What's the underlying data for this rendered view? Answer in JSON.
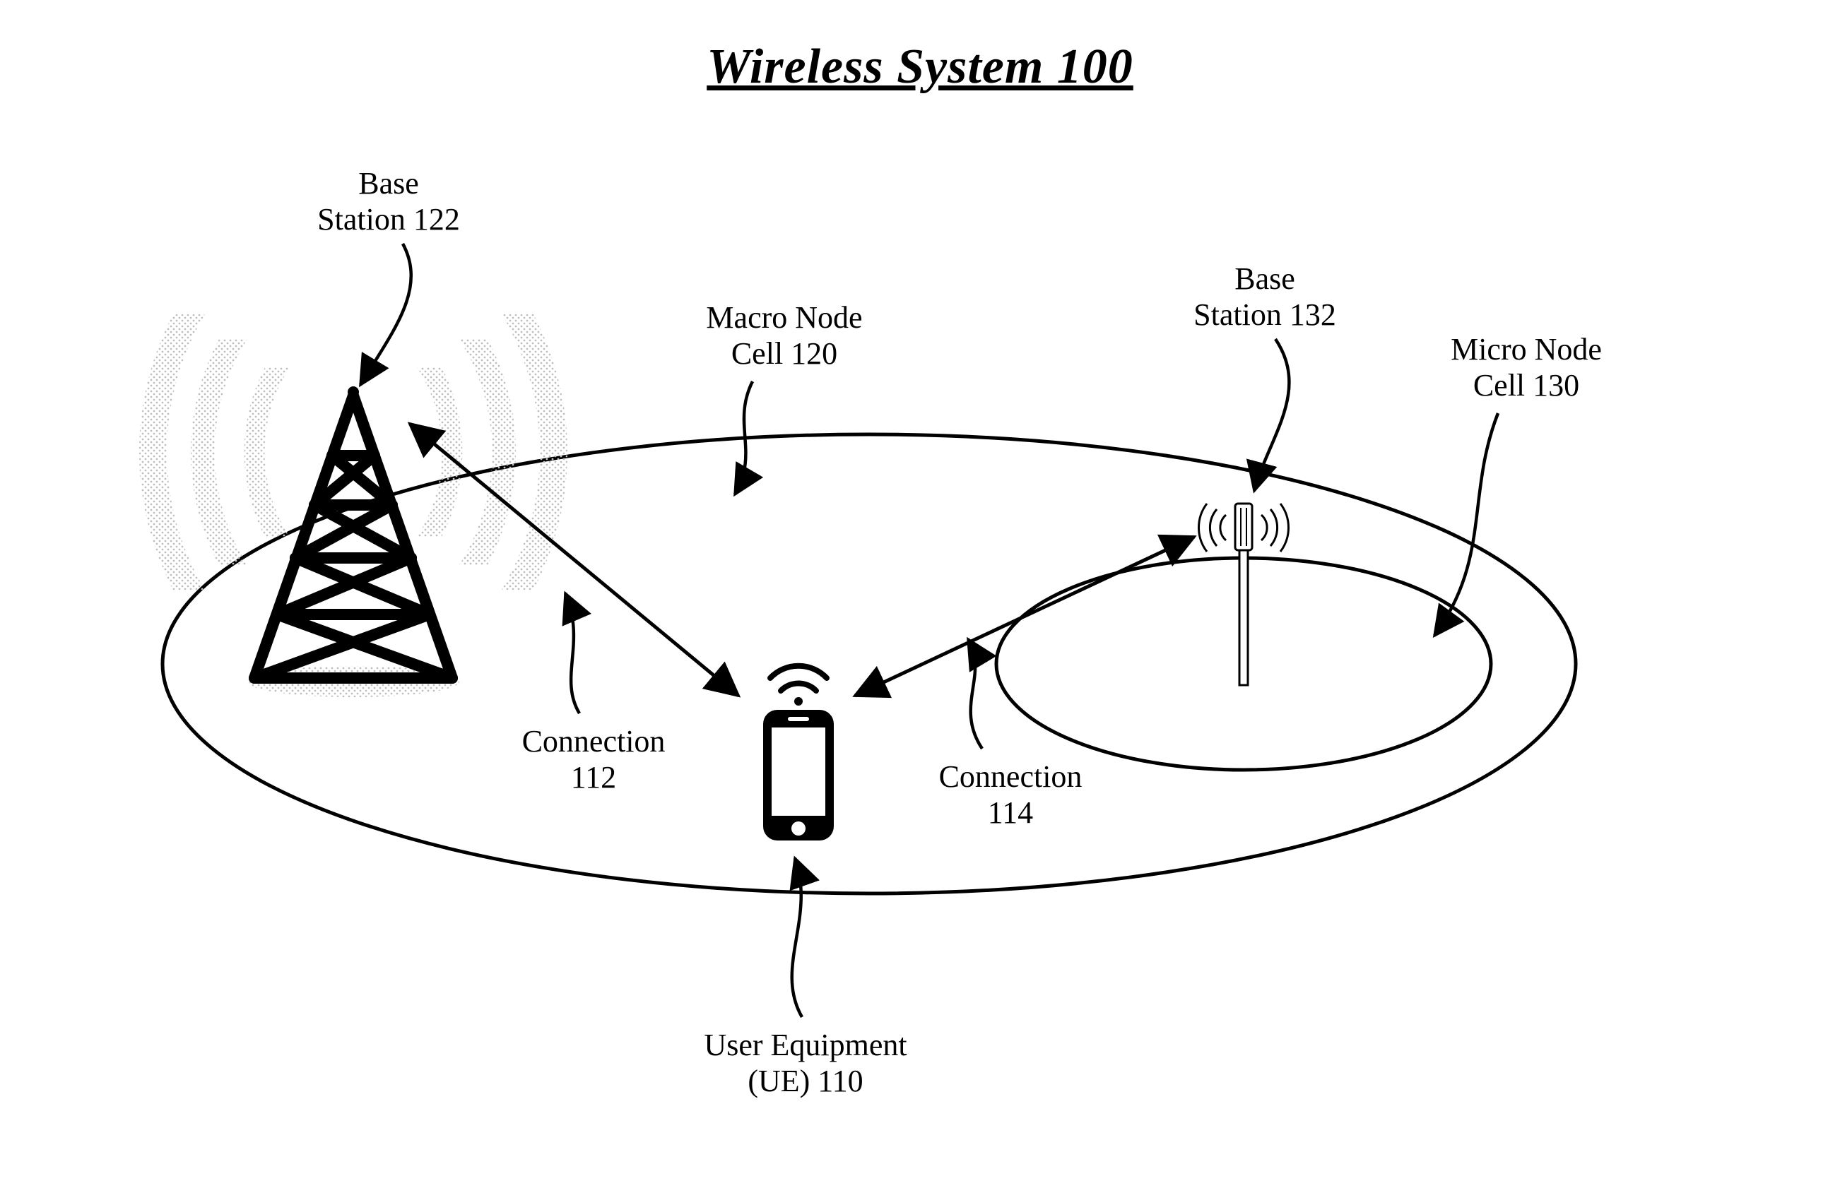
{
  "title": "Wireless System 100",
  "labels": {
    "base_station_122_l1": "Base",
    "base_station_122_l2": "Station 122",
    "macro_cell_l1": "Macro Node",
    "macro_cell_l2": "Cell 120",
    "base_station_132_l1": "Base",
    "base_station_132_l2": "Station 132",
    "micro_cell_l1": "Micro Node",
    "micro_cell_l2": "Cell 130",
    "connection_112_l1": "Connection",
    "connection_112_l2": "112",
    "connection_114_l1": "Connection",
    "connection_114_l2": "114",
    "ue_l1": "User Equipment",
    "ue_l2": "(UE) 110"
  }
}
